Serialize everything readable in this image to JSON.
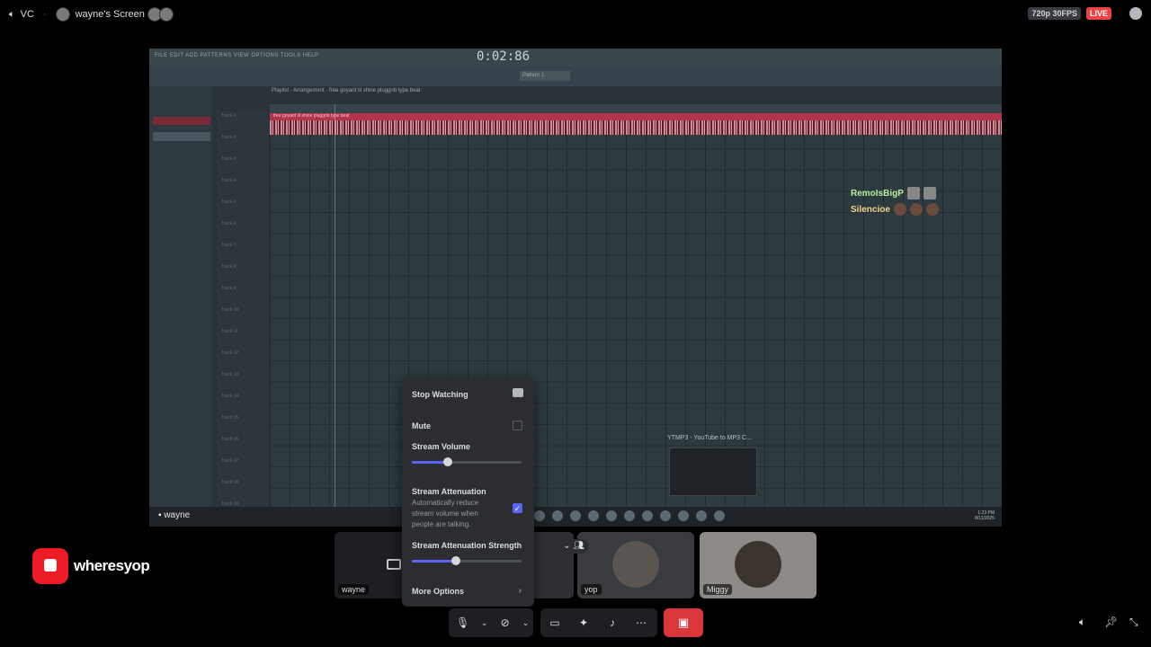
{
  "topbar": {
    "channel": "VC",
    "stream_title": "wayne's Screen",
    "quality": "720p 30FPS",
    "live": "LIVE"
  },
  "screen": {
    "timer": "0:02:86",
    "pattern": "Pattern 1",
    "playlist_title": "Playlist - Arrangement · free goyard lil shine pluggnb type beat",
    "clip_label": "free goyard lil shine pluggnb type beat",
    "track_prefix": "Track",
    "speakers": [
      "RemoIsBigP",
      "Silencioe"
    ],
    "ytmp3_caption": "YTMP3 - YouTube to MP3 C...",
    "taskbar_label": "wayne"
  },
  "participants": [
    {
      "name": "wayne"
    },
    {
      "name": "yop"
    },
    {
      "name": "Miggy"
    }
  ],
  "popover": {
    "stop_watching": "Stop Watching",
    "mute": "Mute",
    "mute_checked": false,
    "stream_volume": "Stream Volume",
    "stream_volume_level": 0.33,
    "attenuation": "Stream Attenuation",
    "attenuation_desc": "Automatically reduce stream volume when people are talking.",
    "attenuation_checked": true,
    "attenuation_strength": "Stream Attenuation Strength",
    "attenuation_strength_level": 0.4,
    "more_options": "More Options"
  },
  "brand": {
    "name": "wheresyop"
  },
  "colors": {
    "live": "#ed4245",
    "accent": "#5865f2",
    "end_call": "#da373c",
    "speaker1": "#b8ef9d",
    "speaker2": "#f0d58a"
  }
}
